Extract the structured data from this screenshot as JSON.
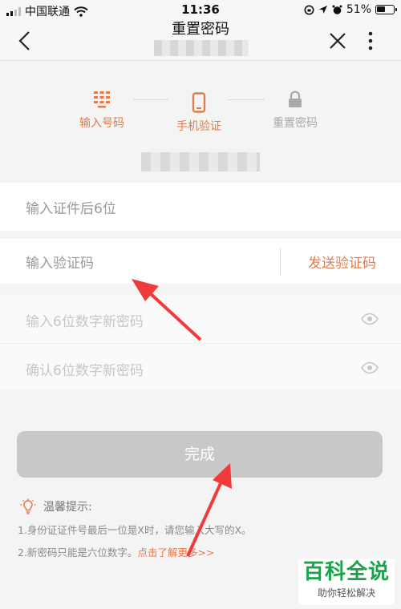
{
  "status_bar": {
    "carrier": "中国联通",
    "time": "11:36",
    "battery": "51%",
    "battery_level": 0.51
  },
  "nav": {
    "title": "重置密码"
  },
  "steps": [
    {
      "label": "输入号码",
      "icon": "keypad-icon",
      "state": "done"
    },
    {
      "label": "手机验证",
      "icon": "phone-icon",
      "state": "active"
    },
    {
      "label": "重置密码",
      "icon": "lock-icon",
      "state": "pending"
    }
  ],
  "form": {
    "id_placeholder": "输入证件后6位",
    "code_placeholder": "输入验证码",
    "send_code_label": "发送验证码",
    "new_password_placeholder": "输入6位数字新密码",
    "confirm_password_placeholder": "确认6位数字新密码",
    "submit_label": "完成"
  },
  "tips": {
    "title": "温馨提示:",
    "line1": "1.身份证证件号最后一位是X时，请您输入大写的X。",
    "line2_text": "2.新密码只能是六位数字。",
    "line2_link": "点击了解更多>>"
  },
  "watermark": {
    "brand": "百科全说",
    "slogan": "助你轻松解决"
  },
  "colors": {
    "accent": "#e07c4a",
    "disabled_button": "#c8c8c8",
    "annotation_arrow": "#ef3b3b",
    "watermark_green": "#1aa34a"
  }
}
